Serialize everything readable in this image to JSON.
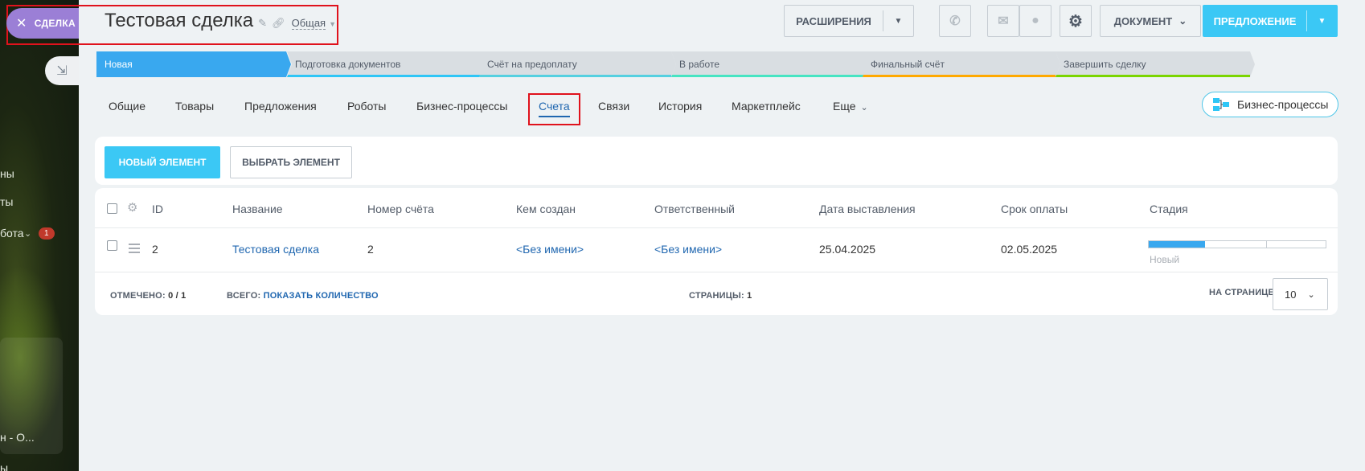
{
  "slider": {
    "tab_label": "СДЕЛКА"
  },
  "left_menu": {
    "item1": "ны",
    "item2": "ты",
    "item3": "бота",
    "item3_badge": "1",
    "item4": "н - О...",
    "item5": "ы"
  },
  "header": {
    "title": "Тестовая сделка",
    "category": "Общая"
  },
  "toolbar": {
    "extensions": "РАСШИРЕНИЯ",
    "document": "ДОКУМЕНТ",
    "offer": "ПРЕДЛОЖЕНИЕ"
  },
  "stages": [
    {
      "label": "Новая",
      "color": "#39a8ef"
    },
    {
      "label": "Подготовка документов",
      "color": "#2fc6f6"
    },
    {
      "label": "Счёт на предоплату",
      "color": "#55d0e0"
    },
    {
      "label": "В работе",
      "color": "#47e4c2"
    },
    {
      "label": "Финальный счёт",
      "color": "#ffa900"
    },
    {
      "label": "Завершить сделку",
      "color": "#7bd500"
    }
  ],
  "tabs": [
    "Общие",
    "Товары",
    "Предложения",
    "Роботы",
    "Бизнес-процессы",
    "Счета",
    "Связи",
    "История",
    "Маркетплейс",
    "Еще"
  ],
  "active_tab": "Счета",
  "bp_button": "Бизнес-процессы",
  "actions": {
    "new_element": "НОВЫЙ ЭЛЕМЕНТ",
    "pick_element": "ВЫБРАТЬ ЭЛЕМЕНТ"
  },
  "grid": {
    "columns": [
      "ID",
      "Название",
      "Номер счёта",
      "Кем создан",
      "Ответственный",
      "Дата выставления",
      "Срок оплаты",
      "Стадия"
    ],
    "rows": [
      {
        "id": "2",
        "name": "Тестовая сделка",
        "number": "2",
        "created_by": "<Без имени>",
        "responsible": "<Без имени>",
        "date_issued": "25.04.2025",
        "due_date": "02.05.2025",
        "stage": "Новый",
        "stage_progress": 0.32
      }
    ]
  },
  "footer": {
    "marked_label": "ОТМЕЧЕНО:",
    "marked_value": "0 / 1",
    "total_label": "ВСЕГО:",
    "total_link": "ПОКАЗАТЬ КОЛИЧЕСТВО",
    "pages_label": "СТРАНИЦЫ:",
    "pages_value": "1",
    "per_page_label": "НА СТРАНИЦЕ:",
    "per_page_value": "10"
  }
}
